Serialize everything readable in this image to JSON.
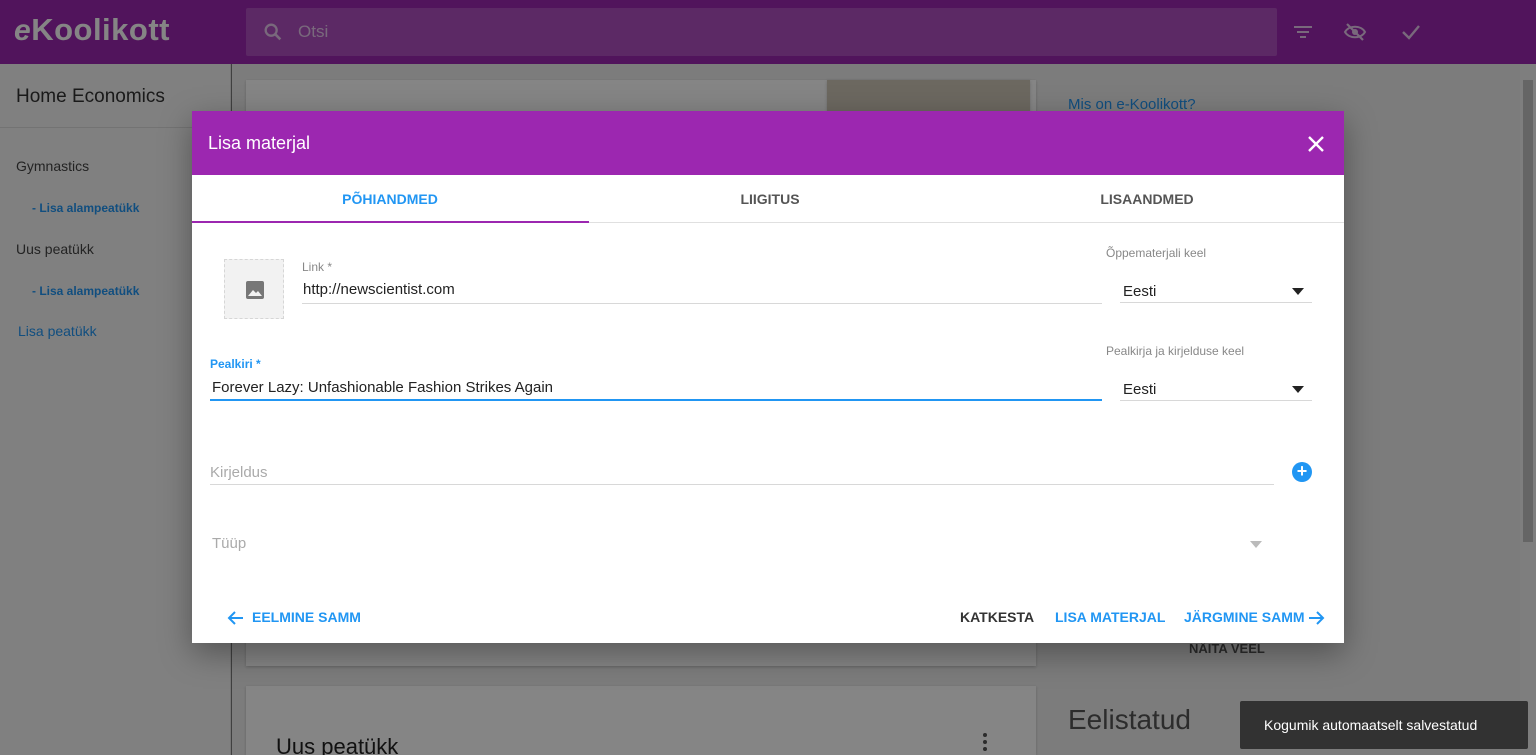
{
  "app": {
    "logo_e": "e",
    "logo_text": "Koolikott",
    "search_placeholder": "Otsi",
    "icons": [
      "search-icon",
      "filter-icon",
      "visibility-off-icon",
      "check-icon"
    ],
    "accent_color": "#9c27b0",
    "link_color": "#2196f3"
  },
  "sidebar": {
    "title": "Home Economics",
    "chapters": [
      {
        "label": "Gymnastics",
        "sub": "- Lisa alampeatükk"
      },
      {
        "label": "Uus peatükk",
        "sub": "- Lisa alampeatükk"
      }
    ],
    "add_chapter": "Lisa peatükk"
  },
  "background": {
    "right_link": "Mis on e-Koolikott?",
    "show_more": "NÄITA VEEL",
    "featured_heading": "Eelistatud",
    "chapter_title": "Uus peatükk"
  },
  "dialog": {
    "title": "Lisa materjal",
    "tabs": [
      {
        "label": "PÕHIANDMED",
        "active": true
      },
      {
        "label": "LIIGITUS",
        "active": false
      },
      {
        "label": "LISAANDMED",
        "active": false
      }
    ],
    "link": {
      "label": "Link *",
      "value": "http://newscientist.com"
    },
    "material_language": {
      "label": "Õppematerjali keel",
      "value": "Eesti"
    },
    "title_field": {
      "label": "Pealkiri *",
      "value": "Forever Lazy: Unfashionable Fashion Strikes Again"
    },
    "title_language": {
      "label": "Pealkirja ja kirjelduse keel",
      "value": "Eesti"
    },
    "description": {
      "placeholder": "Kirjeldus"
    },
    "type": {
      "placeholder": "Tüüp"
    },
    "buttons": {
      "prev": "EELMINE SAMM",
      "cancel": "KATKESTA",
      "add": "LISA MATERJAL",
      "next": "JÄRGMINE SAMM"
    }
  },
  "snackbar": {
    "text": "Kogumik automaatselt salvestatud"
  }
}
